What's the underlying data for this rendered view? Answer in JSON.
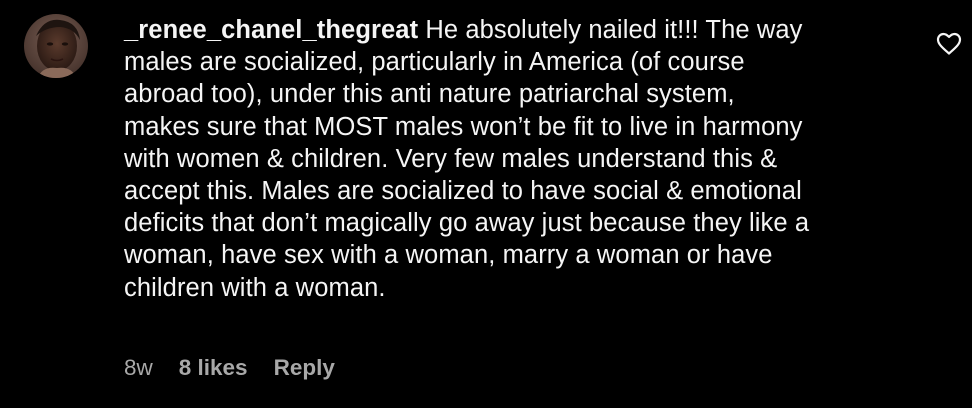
{
  "comment": {
    "username": "_renee_chanel_thegreat",
    "text": "He absolutely nailed it!!! The way\nmales are socialized, particularly in America (of course\nabroad too), under this anti nature patriarchal system,\nmakes sure that MOST males won’t be fit to live in harmony\nwith women & children. Very few males understand this &\naccept this. Males are socialized to have social & emotional\ndeficits that don’t magically go away just because they like a\nwoman, have sex with a woman, marry a woman or have\nchildren with a woman.",
    "time": "8w",
    "likes": "8 likes",
    "reply_label": "Reply",
    "like_icon": "heart-outline-icon"
  },
  "colors": {
    "background": "#000000",
    "text": "#f5f5f5",
    "meta": "#a8a8a8"
  }
}
